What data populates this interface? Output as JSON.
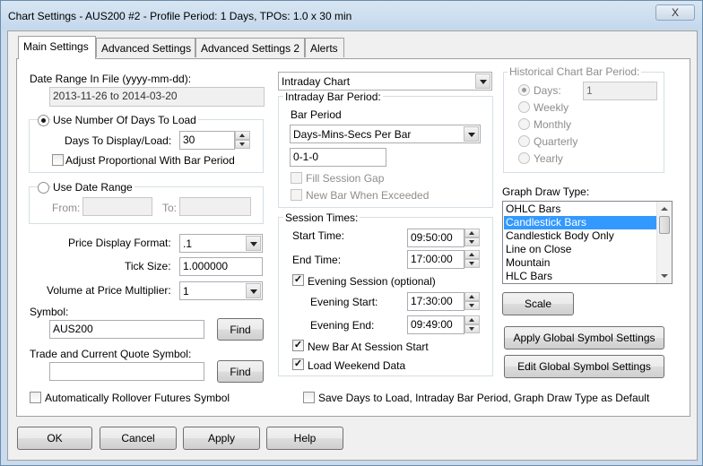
{
  "window": {
    "title": "Chart Settings - AUS200  #2 - Profile Period: 1 Days, TPOs: 1.0 x 30 min",
    "close_label": "X"
  },
  "tabs": [
    {
      "label": "Main Settings"
    },
    {
      "label": "Advanced Settings"
    },
    {
      "label": "Advanced Settings 2"
    },
    {
      "label": "Alerts"
    }
  ],
  "left": {
    "date_range_label": "Date Range In File (yyyy-mm-dd):",
    "date_range_value": "2013-11-26 to 2014-03-20",
    "use_days_label": "Use Number Of Days To Load",
    "days_to_display_label": "Days To Display/Load:",
    "days_to_display_value": "30",
    "adjust_proportional_label": "Adjust Proportional With Bar Period",
    "use_date_range_label": "Use Date Range",
    "from_label": "From:",
    "to_label": "To:",
    "price_display_format_label": "Price Display Format:",
    "price_display_format_value": ".1",
    "tick_size_label": "Tick Size:",
    "tick_size_value": "1.000000",
    "volume_multiplier_label": "Volume at Price Multiplier:",
    "volume_multiplier_value": "1",
    "symbol_label": "Symbol:",
    "symbol_value": "AUS200",
    "find_label": "Find",
    "trade_quote_label": "Trade and Current Quote Symbol:",
    "trade_quote_value": "",
    "find2_label": "Find",
    "auto_rollover_label": "Automatically Rollover Futures Symbol"
  },
  "middle": {
    "chart_type_value": "Intraday Chart",
    "intraday_bar_period_title": "Intraday Bar Period:",
    "bar_period_label": "Bar Period",
    "bar_period_type_value": "Days-Mins-Secs Per Bar",
    "bar_period_value": "0-1-0",
    "fill_session_gap_label": "Fill Session Gap",
    "new_bar_exceeded_label": "New Bar When Exceeded",
    "session_times_title": "Session Times:",
    "start_time_label": "Start Time:",
    "start_time_value": "09:50:00",
    "end_time_label": "End Time:",
    "end_time_value": "17:00:00",
    "evening_session_label": "Evening Session (optional)",
    "evening_start_label": "Evening Start:",
    "evening_start_value": "17:30:00",
    "evening_end_label": "Evening End:",
    "evening_end_value": "09:49:00",
    "new_bar_session_label": "New Bar At Session Start",
    "load_weekend_label": "Load Weekend Data"
  },
  "right": {
    "historical_title": "Historical Chart Bar Period:",
    "days_label": "Days:",
    "days_value": "1",
    "weekly_label": "Weekly",
    "monthly_label": "Monthly",
    "quarterly_label": "Quarterly",
    "yearly_label": "Yearly",
    "graph_draw_type_label": "Graph Draw Type:",
    "graph_draw_types": [
      "OHLC Bars",
      "Candlestick Bars",
      "Candlestick Body Only",
      "Line on Close",
      "Mountain",
      "HLC Bars"
    ],
    "selected_draw_type": "Candlestick Bars",
    "scale_label": "Scale",
    "apply_global_label": "Apply Global Symbol Settings",
    "edit_global_label": "Edit Global Symbol Settings"
  },
  "save_default_label": "Save Days to Load, Intraday Bar Period, Graph Draw Type as Default",
  "buttons": {
    "ok": "OK",
    "cancel": "Cancel",
    "apply": "Apply",
    "help": "Help"
  }
}
